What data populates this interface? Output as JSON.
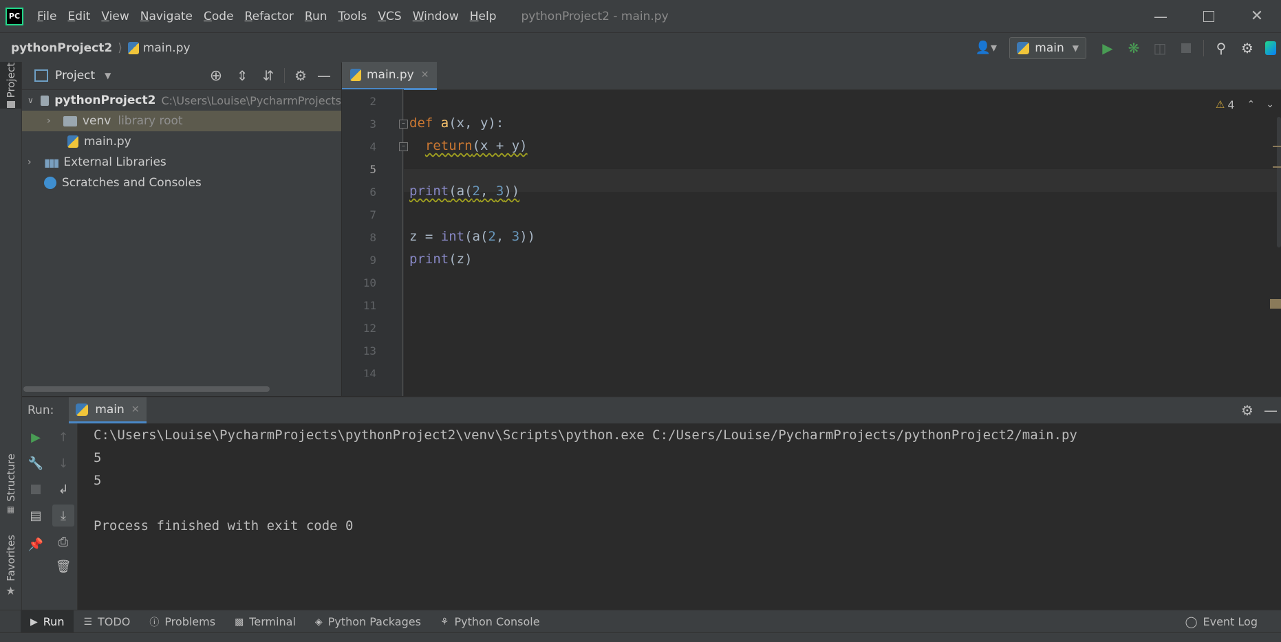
{
  "app": {
    "logo_text": "PC",
    "window_title": "pythonProject2 - main.py"
  },
  "menu": [
    "File",
    "Edit",
    "View",
    "Navigate",
    "Code",
    "Refactor",
    "Run",
    "Tools",
    "VCS",
    "Window",
    "Help"
  ],
  "breadcrumb": {
    "project": "pythonProject2",
    "file": "main.py"
  },
  "run_config": {
    "name": "main"
  },
  "left_strip": {
    "project": "Project",
    "structure": "Structure",
    "favorites": "Favorites"
  },
  "project_panel": {
    "title": "Project",
    "tree": [
      {
        "label": "pythonProject2",
        "hint": "C:\\Users\\Louise\\PycharmProjects"
      },
      {
        "label": "venv",
        "hint": "library root"
      },
      {
        "label": "main.py",
        "hint": ""
      },
      {
        "label": "External Libraries",
        "hint": ""
      },
      {
        "label": "Scratches and Consoles",
        "hint": ""
      }
    ]
  },
  "editor": {
    "tab": "main.py",
    "warning_count": "4",
    "line_numbers": [
      "2",
      "3",
      "4",
      "5",
      "6",
      "7",
      "8",
      "9",
      "10",
      "11",
      "12",
      "13",
      "14"
    ],
    "current_line": "5",
    "code": {
      "l3_def": "def",
      "l3_name": "a",
      "l3_rest": "(x, y):",
      "l4_return": "return",
      "l4_rest": "(x + y)",
      "l6_print": "print",
      "l6_a": "(a(",
      "l6_n1": "2",
      "l6_comma": ", ",
      "l6_n2": "3",
      "l6_end": "))",
      "l8_z": "z = ",
      "l8_int": "int",
      "l8_a": "(a(",
      "l8_n1": "2",
      "l8_comma": ", ",
      "l8_n2": "3",
      "l8_end": "))",
      "l9_print": "print",
      "l9_rest": "(z)"
    }
  },
  "run_panel": {
    "label": "Run:",
    "tab": "main",
    "console": [
      "C:\\Users\\Louise\\PycharmProjects\\pythonProject2\\venv\\Scripts\\python.exe C:/Users/Louise/PycharmProjects/pythonProject2/main.py",
      "5",
      "5",
      "",
      "Process finished with exit code 0"
    ]
  },
  "bottom_tabs": [
    "Run",
    "TODO",
    "Problems",
    "Terminal",
    "Python Packages",
    "Python Console"
  ],
  "event_log": "Event Log",
  "colors": {
    "bg": "#2b2b2b",
    "panel": "#3c3f41",
    "run_green": "#499c54",
    "keyword": "#cc7832",
    "function": "#ffc66d",
    "builtin": "#8888c6",
    "number": "#6897bb"
  }
}
